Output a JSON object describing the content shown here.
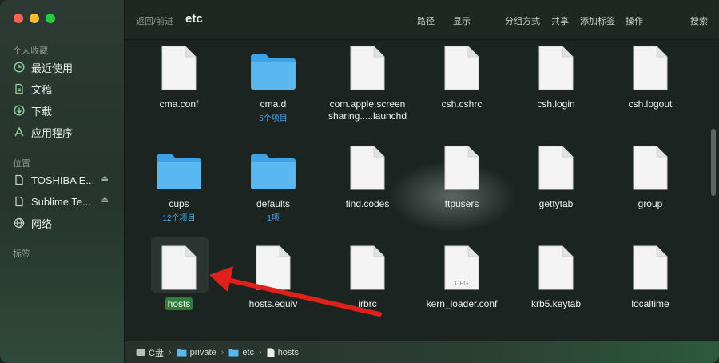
{
  "sidebar": {
    "favorites_label": "个人收藏",
    "favorites": [
      {
        "label": "最近使用",
        "icon": "clock-icon"
      },
      {
        "label": "文稿",
        "icon": "document-icon"
      },
      {
        "label": "下载",
        "icon": "download-icon"
      },
      {
        "label": "应用程序",
        "icon": "apps-icon"
      }
    ],
    "locations_label": "位置",
    "locations": [
      {
        "label": "TOSHIBA E...",
        "icon": "drive-icon"
      },
      {
        "label": "Sublime Te...",
        "icon": "drive-icon"
      },
      {
        "label": "网络",
        "icon": "globe-icon"
      }
    ],
    "tags_label": "标签"
  },
  "toolbar": {
    "nav": "返回/前进",
    "title": "etc",
    "path": "路径",
    "view": "显示",
    "group": "分组方式",
    "share": "共享",
    "tag": "添加标签",
    "action": "操作",
    "search": "搜索"
  },
  "files": [
    {
      "name": "cma.conf",
      "kind": "file"
    },
    {
      "name": "cma.d",
      "kind": "folder",
      "sub": "5个项目"
    },
    {
      "name": "com.apple.screen",
      "name2": "sharing.....launchd",
      "kind": "file"
    },
    {
      "name": "csh.cshrc",
      "kind": "file"
    },
    {
      "name": "csh.login",
      "kind": "file"
    },
    {
      "name": "csh.logout",
      "kind": "file"
    },
    {
      "name": "cups",
      "kind": "folder",
      "sub": "12个项目"
    },
    {
      "name": "defaults",
      "kind": "folder",
      "sub": "1项"
    },
    {
      "name": "find.codes",
      "kind": "file"
    },
    {
      "name": "ftpusers",
      "kind": "file"
    },
    {
      "name": "gettytab",
      "kind": "file"
    },
    {
      "name": "group",
      "kind": "file"
    },
    {
      "name": "hosts",
      "kind": "file",
      "selected": true
    },
    {
      "name": "hosts.equiv",
      "kind": "file"
    },
    {
      "name": "irbrc",
      "kind": "file"
    },
    {
      "name": "kern_loader.conf",
      "kind": "file",
      "badge": "CFG"
    },
    {
      "name": "krb5.keytab",
      "kind": "file"
    },
    {
      "name": "localtime",
      "kind": "file"
    }
  ],
  "pathbar": {
    "crumbs": [
      "C盘",
      "private",
      "etc",
      "hosts"
    ]
  },
  "colors": {
    "folder": "#5bb7f0",
    "selection": "#2e7d3a",
    "arrow": "#e0201a"
  }
}
